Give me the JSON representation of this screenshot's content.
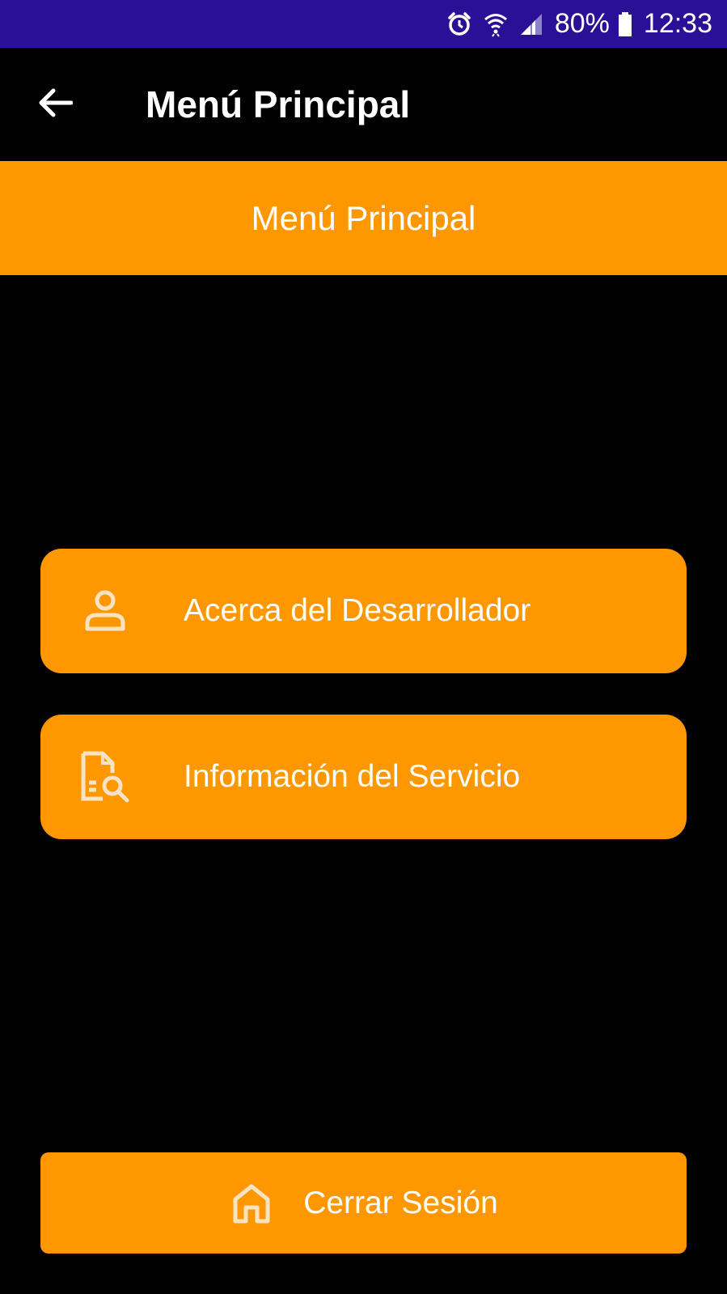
{
  "status_bar": {
    "icons": [
      "alarm-icon",
      "wifi-icon",
      "signal-icon",
      "battery-icon"
    ],
    "battery": "80%",
    "time": "12:33",
    "bg_color": "#2a0f97"
  },
  "app_bar": {
    "back_icon": "arrow-left-icon",
    "title": "Menú Principal"
  },
  "banner": {
    "title": "Menú Principal",
    "color": "#ff9800"
  },
  "menu": {
    "items": [
      {
        "icon": "person-icon",
        "label": "Acerca del Desarrollador"
      },
      {
        "icon": "document-search-icon",
        "label": "Información del Servicio"
      }
    ]
  },
  "logout": {
    "icon": "home-icon",
    "label": "Cerrar Sesión"
  }
}
